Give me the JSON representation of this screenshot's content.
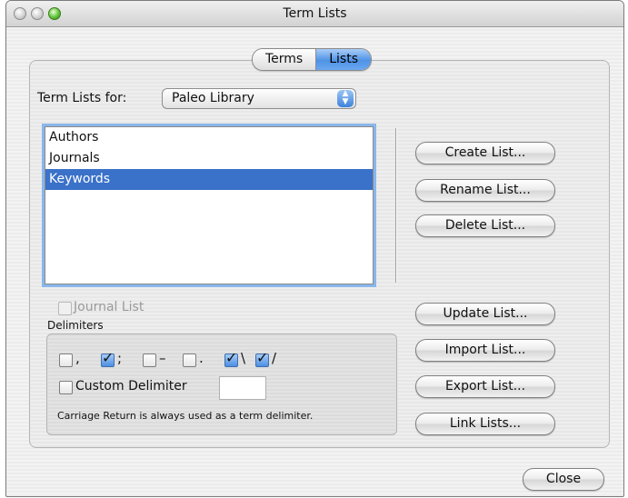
{
  "window": {
    "title": "Term Lists"
  },
  "tabs": [
    {
      "label": "Terms"
    },
    {
      "label": "Lists"
    }
  ],
  "term_lists_for": {
    "label": "Term Lists for:",
    "selected": "Paleo Library"
  },
  "lists": {
    "items": [
      "Authors",
      "Journals",
      "Keywords"
    ],
    "selected_index": 2
  },
  "buttons": {
    "create": "Create List...",
    "rename": "Rename List...",
    "delete": "Delete List...",
    "update": "Update List...",
    "import": "Import List...",
    "export": "Export List...",
    "link": "Link Lists...",
    "close": "Close"
  },
  "journal_list": {
    "label": "Journal List",
    "checked": false,
    "enabled": false
  },
  "delimiters": {
    "title": "Delimiters",
    "items": [
      {
        "symbol": ",",
        "checked": false
      },
      {
        "symbol": ";",
        "checked": true
      },
      {
        "symbol": "–",
        "checked": false
      },
      {
        "symbol": ".",
        "checked": false
      },
      {
        "symbol": "\\",
        "checked": true
      },
      {
        "symbol": "/",
        "checked": true
      }
    ],
    "custom_label": "Custom Delimiter",
    "custom_checked": false,
    "custom_value": "",
    "note": "Carriage Return is always used as a term delimiter."
  }
}
